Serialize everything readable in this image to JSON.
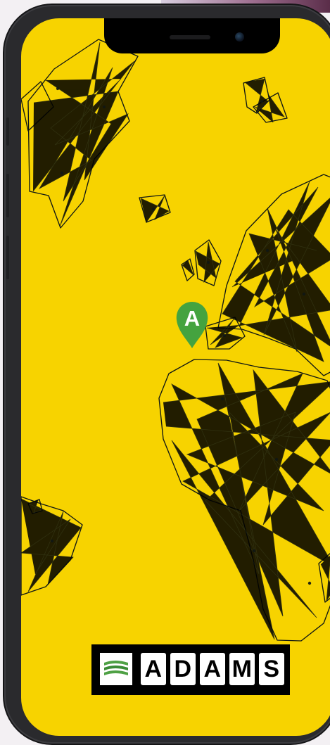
{
  "map": {
    "pin_label": "A"
  },
  "branding": {
    "letters": [
      "A",
      "D",
      "A",
      "M",
      "S"
    ]
  },
  "colors": {
    "screen_background": "#f7d300",
    "map_lines": "#101714",
    "pin": "#44a33f",
    "brand_accent": "#4fa145"
  },
  "icons": {
    "marker": "location-pin-icon",
    "logo": "adams-logo-icon"
  }
}
